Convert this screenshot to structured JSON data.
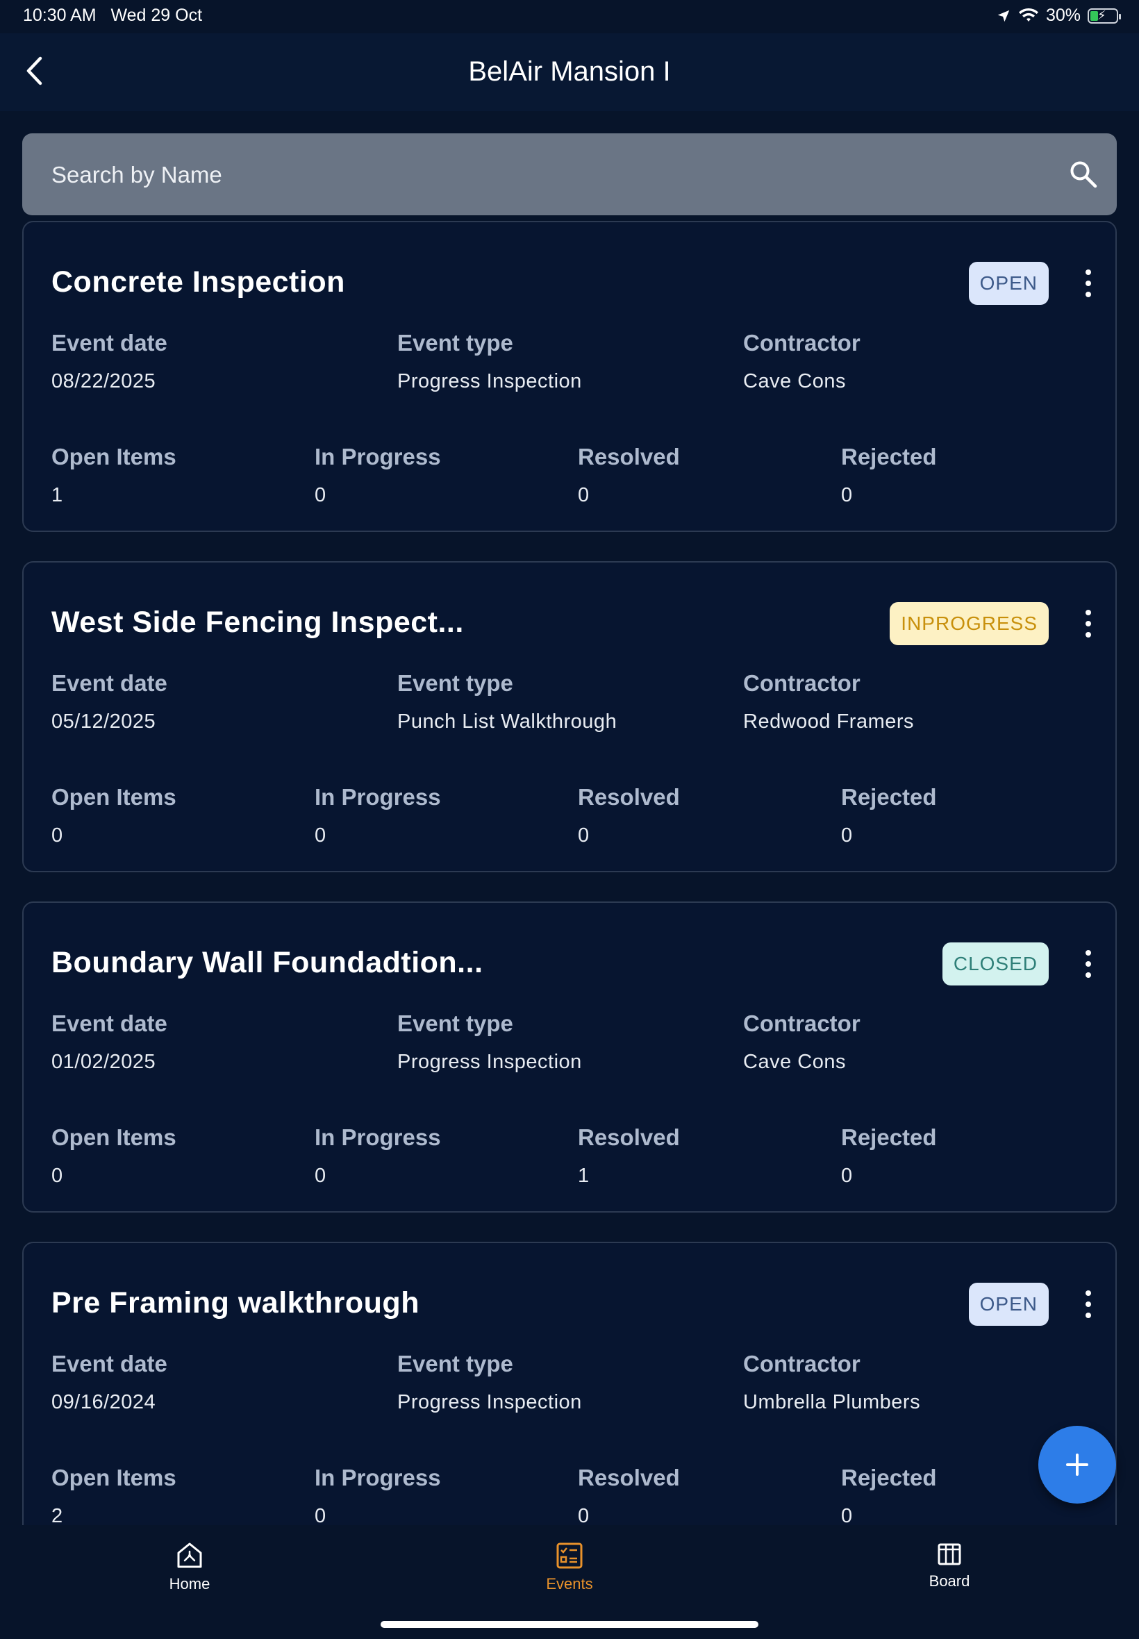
{
  "status_bar": {
    "time": "10:30 AM",
    "date": "Wed 29 Oct",
    "battery": "30%",
    "battery_level": 0.3,
    "icons": [
      "location-icon",
      "wifi-icon",
      "battery-charging-icon"
    ]
  },
  "header": {
    "title": "BelAir Mansion I",
    "back_icon": "chevron-left-icon"
  },
  "search": {
    "placeholder": "Search by Name",
    "value": "",
    "icon": "search-icon"
  },
  "labels": {
    "event_date": "Event date",
    "event_type": "Event type",
    "contractor": "Contractor",
    "open_items": "Open Items",
    "in_progress": "In Progress",
    "resolved": "Resolved",
    "rejected": "Rejected"
  },
  "events": [
    {
      "title": "Concrete Inspection",
      "status": "OPEN",
      "event_date": "08/22/2025",
      "event_type": "Progress Inspection",
      "contractor": "Cave Cons",
      "open_items": "1",
      "in_progress": "0",
      "resolved": "0",
      "rejected": "0"
    },
    {
      "title": "West Side Fencing Inspect...",
      "status": "INPROGRESS",
      "event_date": "05/12/2025",
      "event_type": "Punch List Walkthrough",
      "contractor": "Redwood Framers",
      "open_items": "0",
      "in_progress": "0",
      "resolved": "0",
      "rejected": "0"
    },
    {
      "title": "Boundary Wall Foundadtion...",
      "status": "CLOSED",
      "event_date": "01/02/2025",
      "event_type": "Progress Inspection",
      "contractor": "Cave Cons",
      "open_items": "0",
      "in_progress": "0",
      "resolved": "1",
      "rejected": "0"
    },
    {
      "title": "Pre Framing walkthrough",
      "status": "OPEN",
      "event_date": "09/16/2024",
      "event_type": "Progress Inspection",
      "contractor": "Umbrella Plumbers",
      "open_items": "2",
      "in_progress": "0",
      "resolved": "0",
      "rejected": "0"
    }
  ],
  "status_colors": {
    "OPEN": {
      "bg": "#dbe6fb",
      "fg": "#3d5a8a"
    },
    "INPROGRESS": {
      "bg": "#fdf1c4",
      "fg": "#c8900c"
    },
    "CLOSED": {
      "bg": "#d3f2ef",
      "fg": "#2e7f78"
    }
  },
  "fab": {
    "icon": "plus-icon"
  },
  "bottom_nav": {
    "items": [
      {
        "label": "Home",
        "icon": "home-icon",
        "active": false
      },
      {
        "label": "Events",
        "icon": "events-icon",
        "active": true
      },
      {
        "label": "Board",
        "icon": "board-icon",
        "active": false
      }
    ],
    "active_color": "#e8922b",
    "inactive_color": "#ffffff"
  }
}
